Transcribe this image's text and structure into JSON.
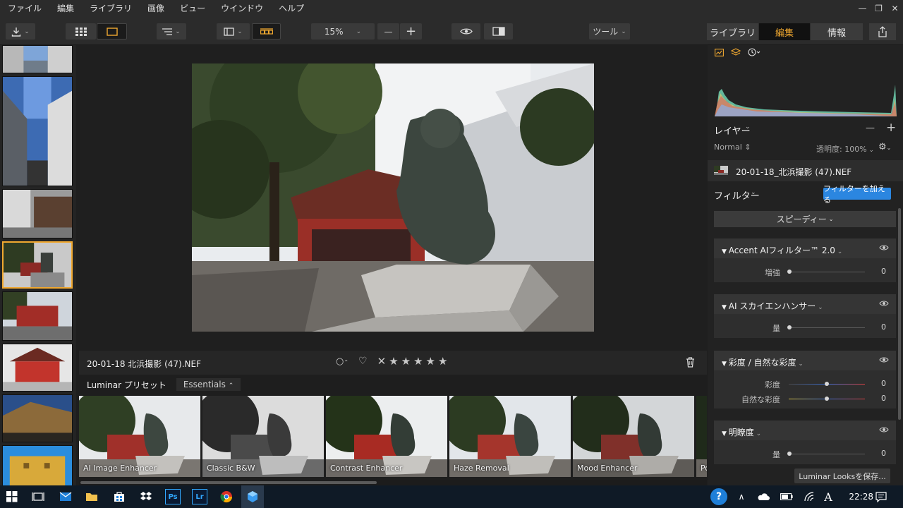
{
  "menu": [
    "ファイル",
    "編集",
    "ライブラリ",
    "画像",
    "ビュー",
    "ウインドウ",
    "ヘルプ"
  ],
  "window_controls": [
    "—",
    "❐",
    "✕"
  ],
  "toolbar": {
    "zoom": "15%",
    "zoom_minus": "—",
    "zoom_plus": "+",
    "tools": "ツール",
    "tabs": [
      {
        "label": "ライブラリ",
        "selected": false
      },
      {
        "label": "編集",
        "selected": true
      },
      {
        "label": "情報",
        "selected": false
      }
    ]
  },
  "image": {
    "filename": "20-01-18 北浜撮影 (47).NEF",
    "stars": 5
  },
  "presets": {
    "title": "Luminar プリセット",
    "category": "Essentials",
    "items": [
      "AI Image Enhancer",
      "Classic B&W",
      "Contrast Enhancer",
      "Haze Removal",
      "Mood Enhancer",
      "Po"
    ]
  },
  "right_panel": {
    "layers_title": "レイヤー",
    "layers_minus": "—",
    "layers_plus": "+",
    "blend_mode": "Normal",
    "opacity": "透明度: 100%",
    "layer_name": "20-01-18_北浜撮影 (47).NEF",
    "filters_title": "フィルター",
    "add_filter": "フィルターを加える",
    "speedy": "スピーディー",
    "filters": [
      {
        "title": "Accent AIフィルター™ 2.0",
        "sliders": [
          {
            "label": "増強",
            "value": "0"
          }
        ]
      },
      {
        "title": "AI スカイエンハンサー",
        "sliders": [
          {
            "label": "量",
            "value": "0"
          }
        ]
      },
      {
        "title": "彩度 / 自然な彩度",
        "sliders": [
          {
            "label": "彩度",
            "value": "0"
          },
          {
            "label": "自然な彩度",
            "value": "0"
          }
        ]
      },
      {
        "title": "明瞭度",
        "sliders": [
          {
            "label": "量",
            "value": "0"
          }
        ]
      }
    ],
    "save_looks": "Luminar Looksを保存..."
  },
  "taskbar": {
    "time": "22:28"
  },
  "colors": {
    "accent": "#f0a830",
    "blue": "#2b86e0"
  }
}
